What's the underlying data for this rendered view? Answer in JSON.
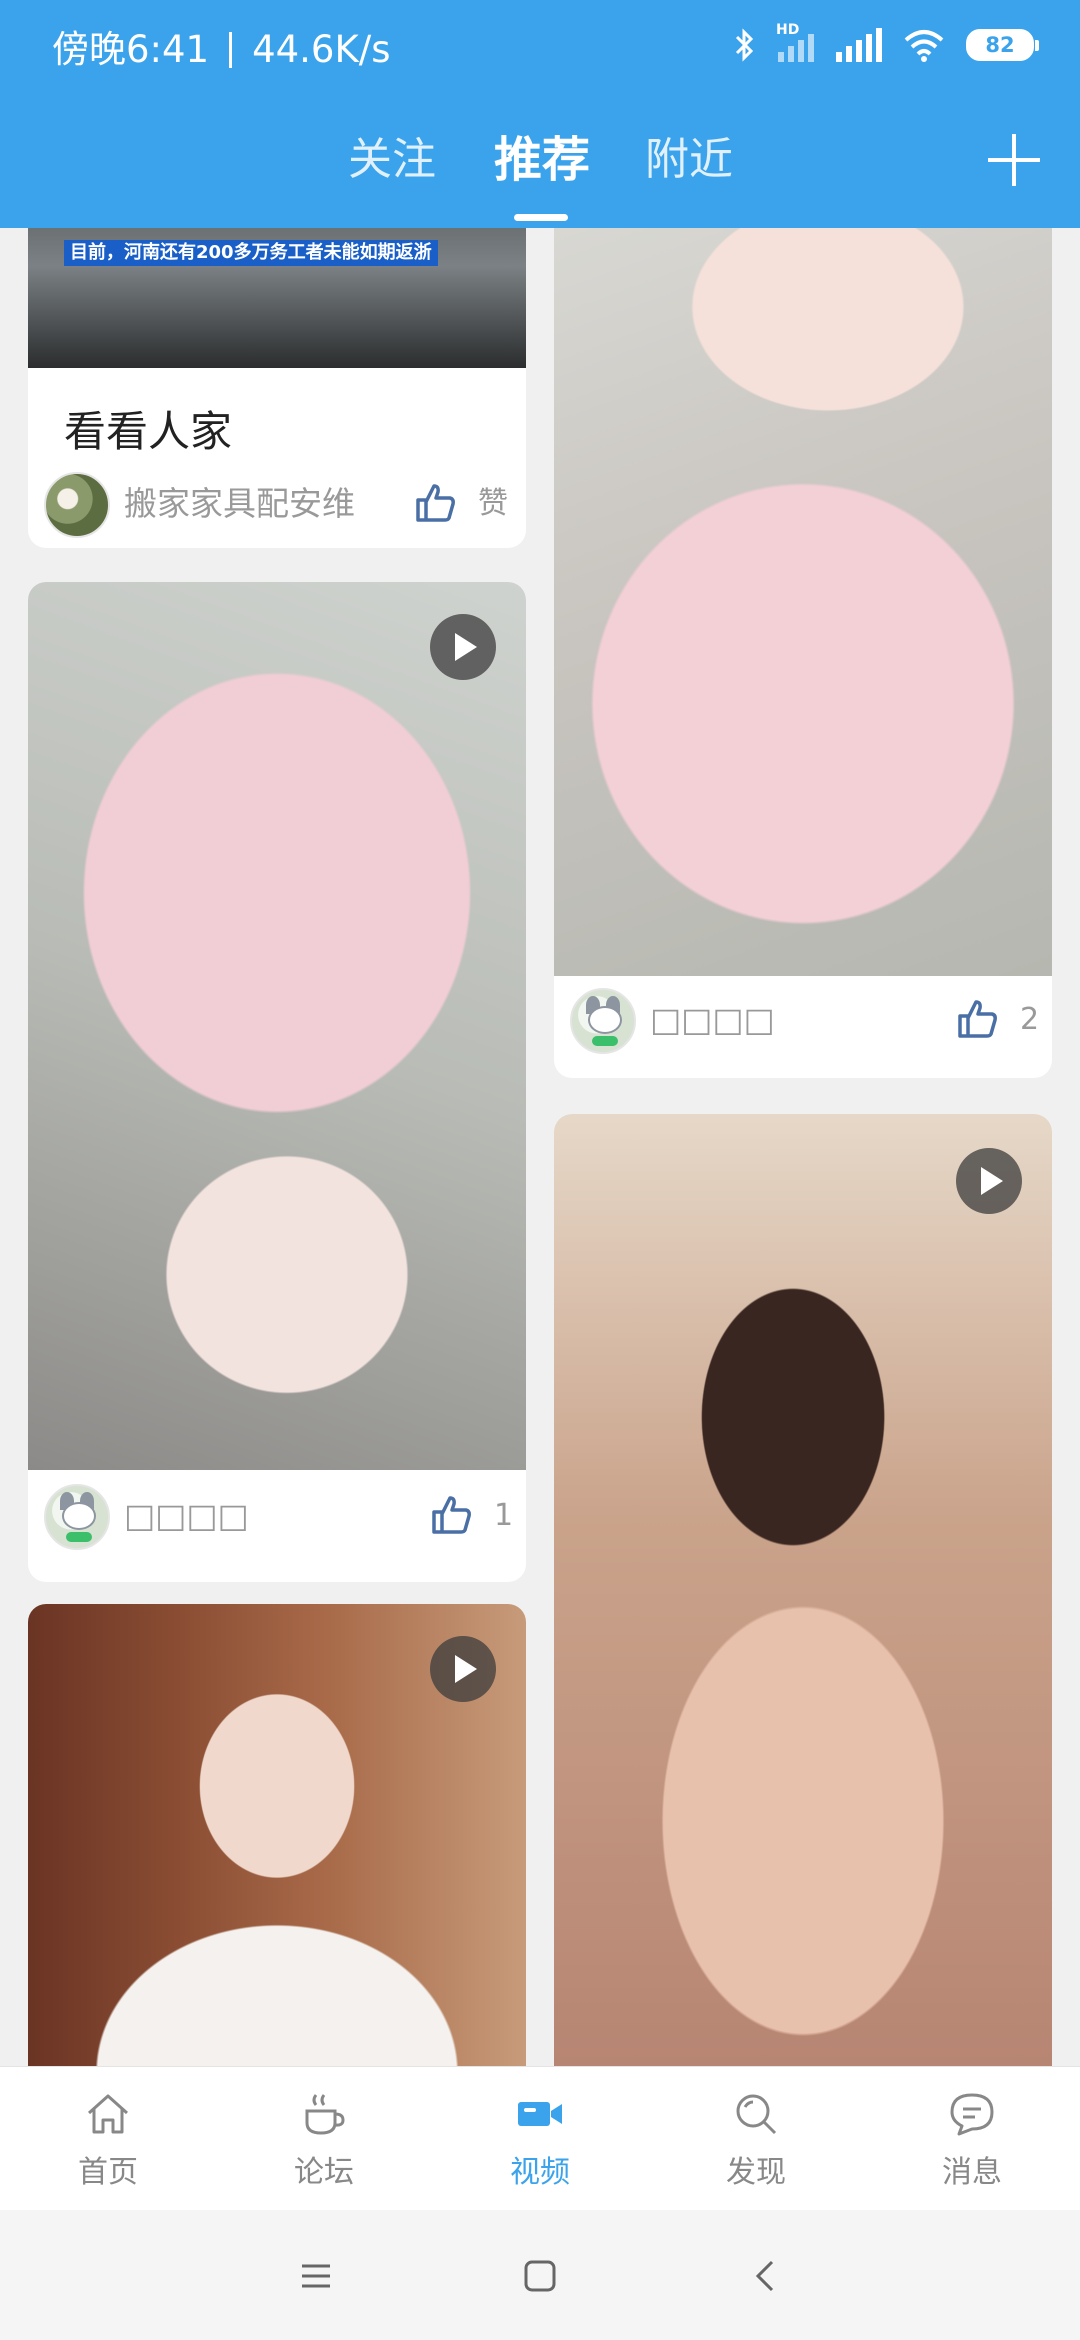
{
  "status_bar": {
    "time": "傍晚6:41",
    "network_speed": "44.6K/s",
    "battery": "82",
    "icons": [
      "bluetooth-icon",
      "hd-signal-icon",
      "cell-signal-icon",
      "wifi-icon",
      "battery-icon"
    ]
  },
  "header": {
    "tabs": [
      {
        "label": "关注",
        "active": false
      },
      {
        "label": "推荐",
        "active": true
      },
      {
        "label": "附近",
        "active": false
      }
    ],
    "add_icon": "plus-icon"
  },
  "feed": {
    "cards": [
      {
        "id": "card1",
        "image_caption": "目前，河南还有200多万务工者未能如期返浙",
        "title": "看看人家",
        "author": "搬家家具配安维",
        "likes": "赞"
      },
      {
        "id": "card2",
        "author": "□□□□",
        "likes": "2"
      },
      {
        "id": "card3",
        "author": "□□□□",
        "likes": "1"
      },
      {
        "id": "card4"
      },
      {
        "id": "card5"
      }
    ]
  },
  "bottom_nav": {
    "items": [
      {
        "label": "首页",
        "icon": "home-icon",
        "active": false
      },
      {
        "label": "论坛",
        "icon": "coffee-cup-icon",
        "active": false
      },
      {
        "label": "视频",
        "icon": "video-camera-icon",
        "active": true
      },
      {
        "label": "发现",
        "icon": "search-icon",
        "active": false
      },
      {
        "label": "消息",
        "icon": "chat-bubble-icon",
        "active": false
      }
    ]
  },
  "colors": {
    "primary": "#3aa3eb",
    "nav_inactive": "#888888",
    "like_icon": "#4a6fa5"
  }
}
